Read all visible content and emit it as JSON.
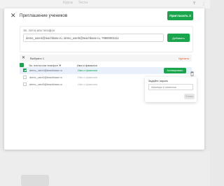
{
  "background": {
    "tabs": [
      "Курсы",
      "Тесты"
    ]
  },
  "modal": {
    "title": "Приглашение учеников",
    "invite_button": "Пригласить 3",
    "email_field": {
      "label": "Эл. почта или телефон",
      "value": "demo_user4@teachbase.ru, demo_user5@teachbase.ru, 79990001111"
    },
    "add_button": "Добавить"
  },
  "selection_bar": {
    "count_label": "Выбрано 1",
    "delete_label": "Удалить"
  },
  "table": {
    "columns": [
      "Эл. почта или телефон",
      "Имя и фамилия"
    ],
    "rows": [
      {
        "email": "demo_user1@teachbase.ru",
        "name": "Имя и фамилия",
        "checked": true,
        "selected": true,
        "action": "Активировать"
      },
      {
        "email": "demo_user2@teachbase.ru",
        "name": "Имя и фамилия",
        "checked": false,
        "selected": false
      },
      {
        "email": "demo_user3@teachbase.ru",
        "name": "Имя и фамилия",
        "checked": false,
        "selected": false
      }
    ]
  },
  "popover": {
    "title": "Задайте пароль",
    "placeholder": "Минимум 6 символов",
    "button": "Готово"
  },
  "colors": {
    "accent": "#19a54b",
    "danger": "#e0592a",
    "selected_row": "#e7f0fb"
  }
}
